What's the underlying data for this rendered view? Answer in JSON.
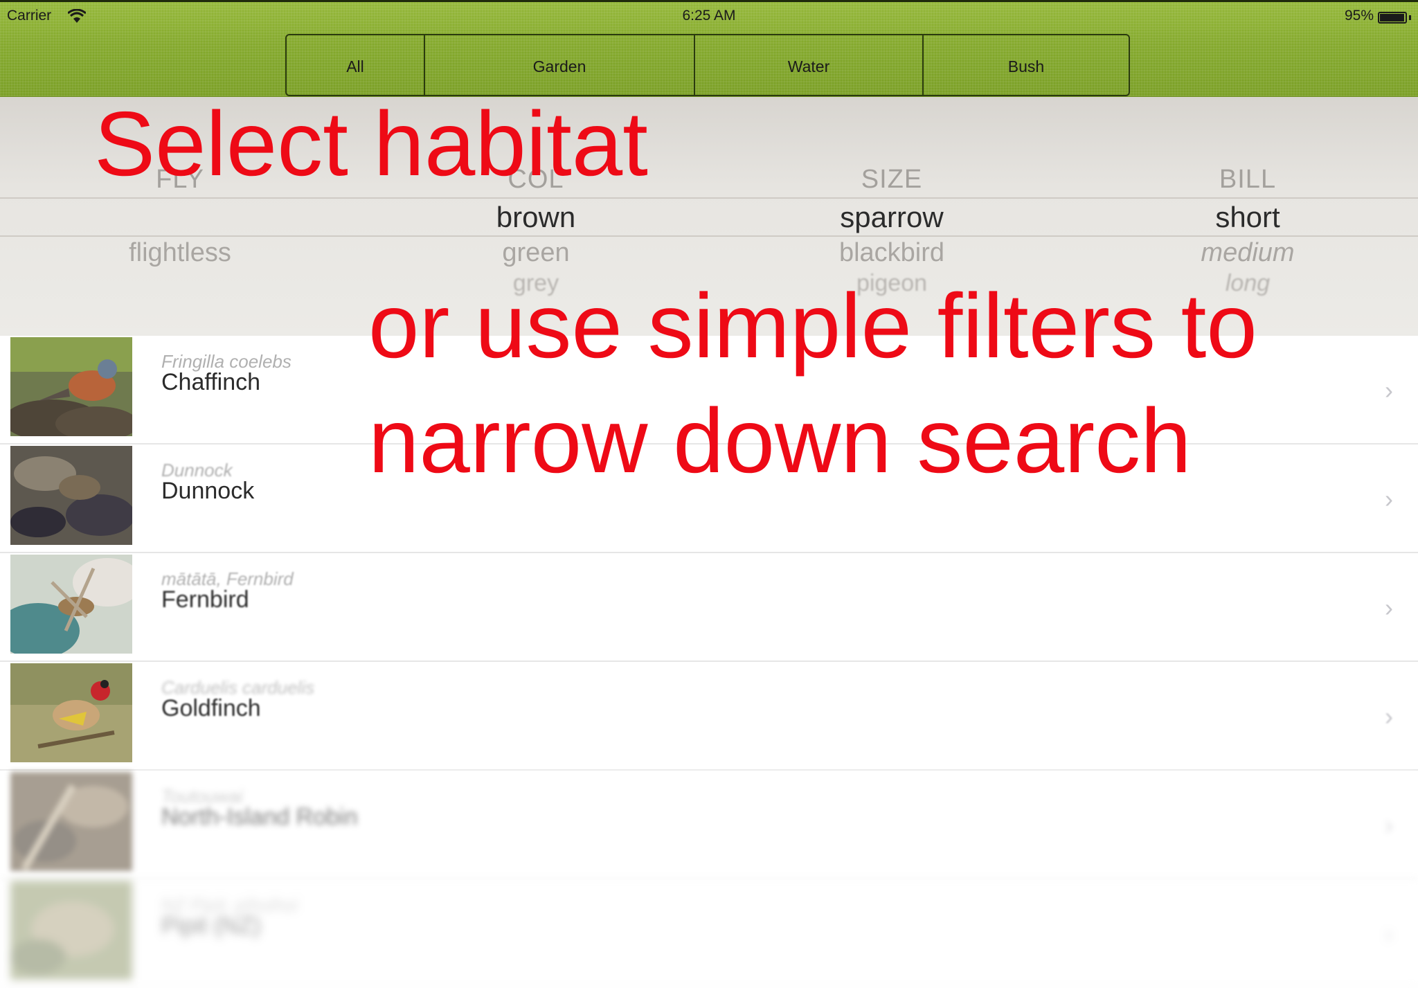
{
  "status_bar": {
    "carrier": "Carrier",
    "time": "6:25 AM",
    "battery": "95%"
  },
  "habitat_tabs": [
    {
      "label": "All"
    },
    {
      "label": "Garden"
    },
    {
      "label": "Water"
    },
    {
      "label": "Bush"
    }
  ],
  "filters": [
    {
      "header": "FLY",
      "selected": "",
      "option1": "flightless",
      "option2": ""
    },
    {
      "header": "COL",
      "selected": "brown",
      "option1": "green",
      "option2": "grey"
    },
    {
      "header": "SIZE",
      "selected": "sparrow",
      "option1": "blackbird",
      "option2": "pigeon"
    },
    {
      "header": "BILL",
      "selected": "short",
      "option1": "medium",
      "option2": "long"
    }
  ],
  "birds": [
    {
      "scientific": "Fringilla coelebs",
      "common": "Chaffinch"
    },
    {
      "scientific": "Dunnock",
      "common": "Dunnock"
    },
    {
      "scientific": "mātātā, Fernbird",
      "common": "Fernbird"
    },
    {
      "scientific": "Carduelis carduelis",
      "common": "Goldfinch"
    },
    {
      "scientific": "Toutouwai",
      "common": "North-Island Robin"
    },
    {
      "scientific": "NZ Pipit, pihoihoi",
      "common": "Pipit (NZ)"
    }
  ],
  "overlay": {
    "line1": "Select habitat",
    "line2": "or use simple filters to",
    "line3": "narrow down search"
  },
  "colors": {
    "header_green": "#86aa2c",
    "caption_red": "#ee0a16"
  }
}
